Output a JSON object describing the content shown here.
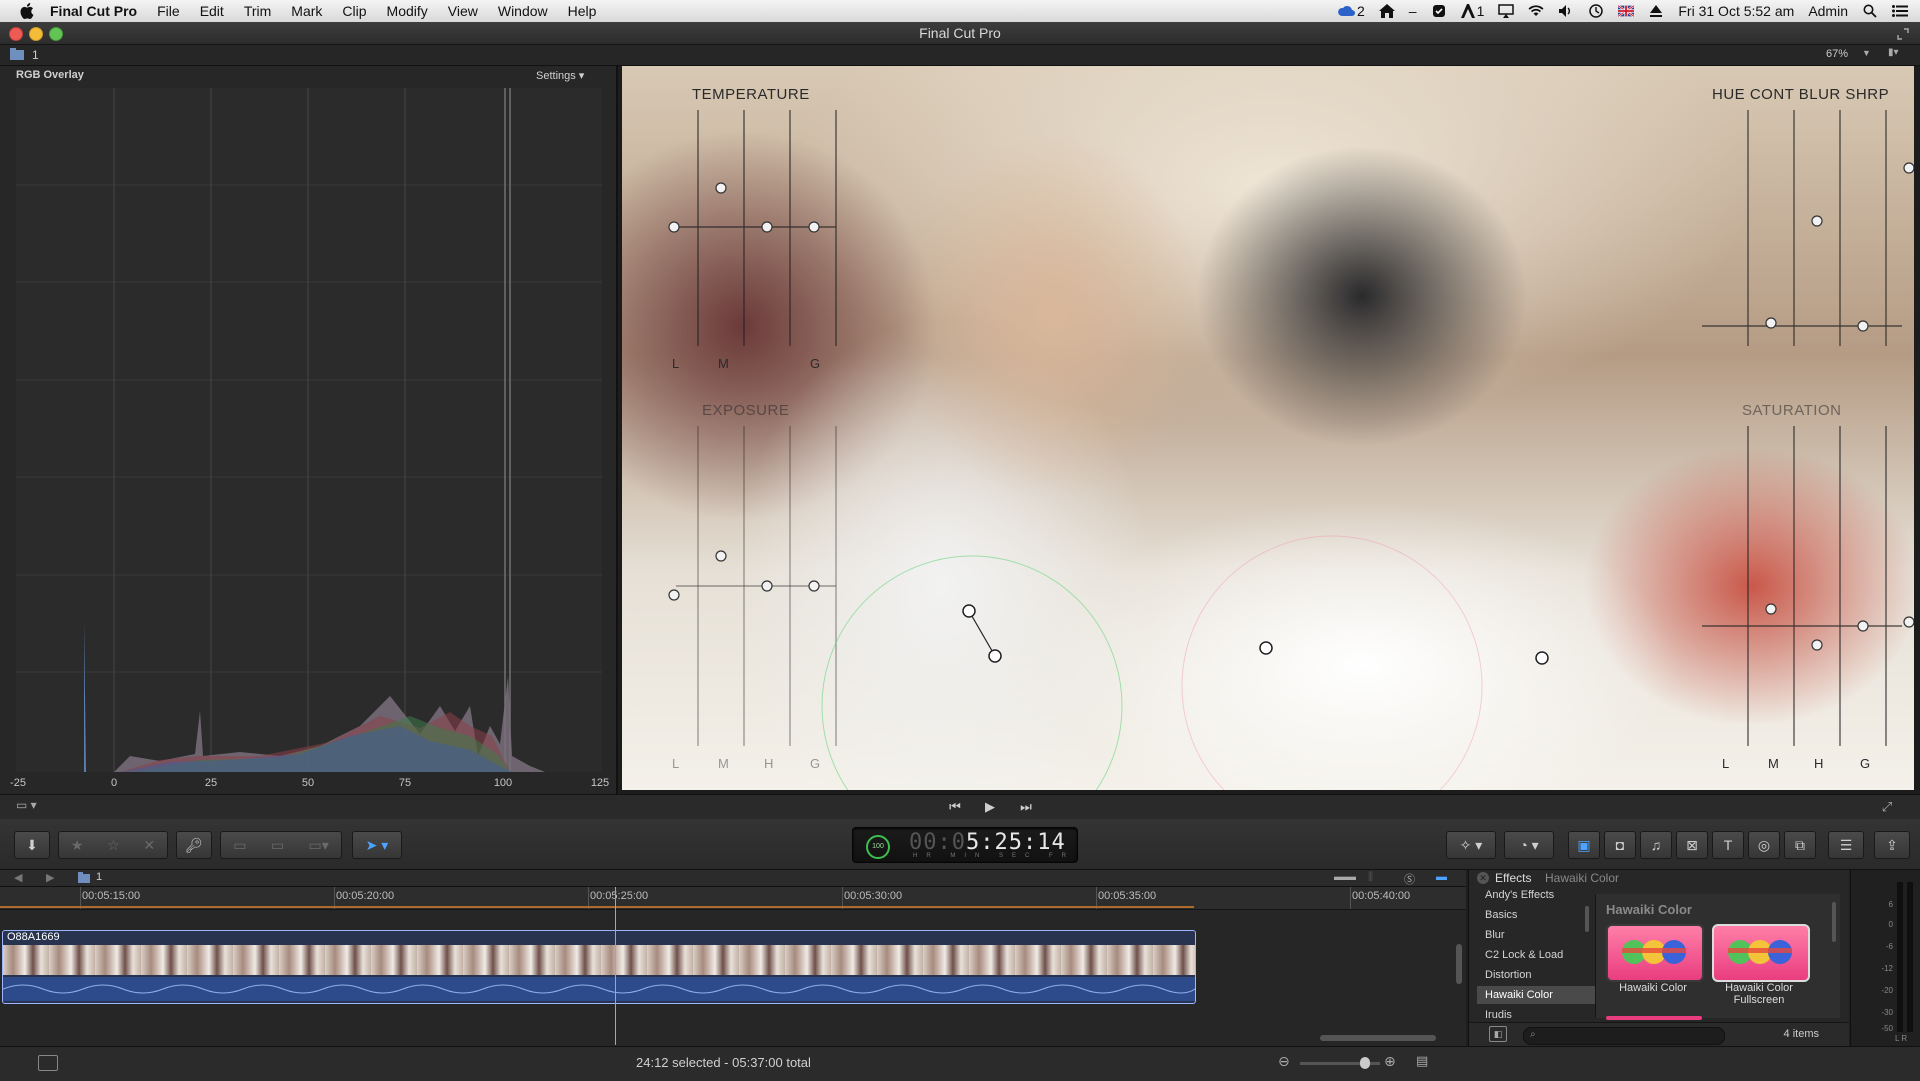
{
  "menubar": {
    "app_name": "Final Cut Pro",
    "items": [
      "File",
      "Edit",
      "Trim",
      "Mark",
      "Clip",
      "Modify",
      "View",
      "Window",
      "Help"
    ],
    "status": {
      "badge_count": "2",
      "minus": "–",
      "adobe_count": "1",
      "datetime": "Fri 31 Oct  5:52 am",
      "user": "Admin"
    }
  },
  "window": {
    "title": "Final Cut Pro"
  },
  "topstrip": {
    "library_index": "1",
    "zoom": "67%"
  },
  "scope": {
    "title": "RGB Overlay",
    "settings_label": "Settings",
    "x_ticks": [
      "-25",
      "0",
      "25",
      "50",
      "75",
      "100",
      "125"
    ]
  },
  "viewer": {
    "overlay_labels": {
      "temperature": "TEMPERATURE",
      "hue_cont_blur_shrp": "HUE  CONT  BLUR  SHRP",
      "exposure": "EXPOSURE",
      "saturation": "SATURATION",
      "lmg_top": [
        "L",
        "M",
        "G"
      ],
      "lmhg_bottom_left": [
        "L",
        "M",
        "H",
        "G"
      ],
      "lmhg_bottom_right": [
        "L",
        "M",
        "H",
        "G"
      ]
    }
  },
  "toolbar": {
    "timecode_prefix": "00:0",
    "timecode_main": "5:25:14",
    "timecode_units": "HR MIN SEC FR",
    "progress_label": "100"
  },
  "timeline": {
    "project_index": "1",
    "ruler": [
      "00:05:15:00",
      "00:05:20:00",
      "00:05:25:00",
      "00:05:30:00",
      "00:05:35:00",
      "00:05:40:00"
    ],
    "clip_name": "O88A1669"
  },
  "effects": {
    "title": "Effects",
    "crumb": "Hawaiki Color",
    "categories": [
      "Andy's Effects",
      "Basics",
      "Blur",
      "C2 Lock & Load",
      "Distortion",
      "Hawaiki Color",
      "Irudis"
    ],
    "selected_category": "Hawaiki Color",
    "group_title": "Hawaiki Color",
    "items": [
      {
        "label_line1": "Hawaiki Color",
        "label_line2": ""
      },
      {
        "label_line1": "Hawaiki Color",
        "label_line2": "Fullscreen"
      }
    ],
    "count": "4 items"
  },
  "meters": {
    "levels": [
      "6",
      "0",
      "-6",
      "-12",
      "-20",
      "-30",
      "-50"
    ],
    "channels": "L R"
  },
  "status": {
    "selection": "24:12 selected - 05:37:00 total"
  },
  "colors": {
    "accent_blue": "#4da3ff",
    "clip_border": "#9db6ff",
    "playhead": "#c9a35a",
    "fx_pink": "#e93d7f",
    "timecode_ring": "#3fbf4f"
  }
}
